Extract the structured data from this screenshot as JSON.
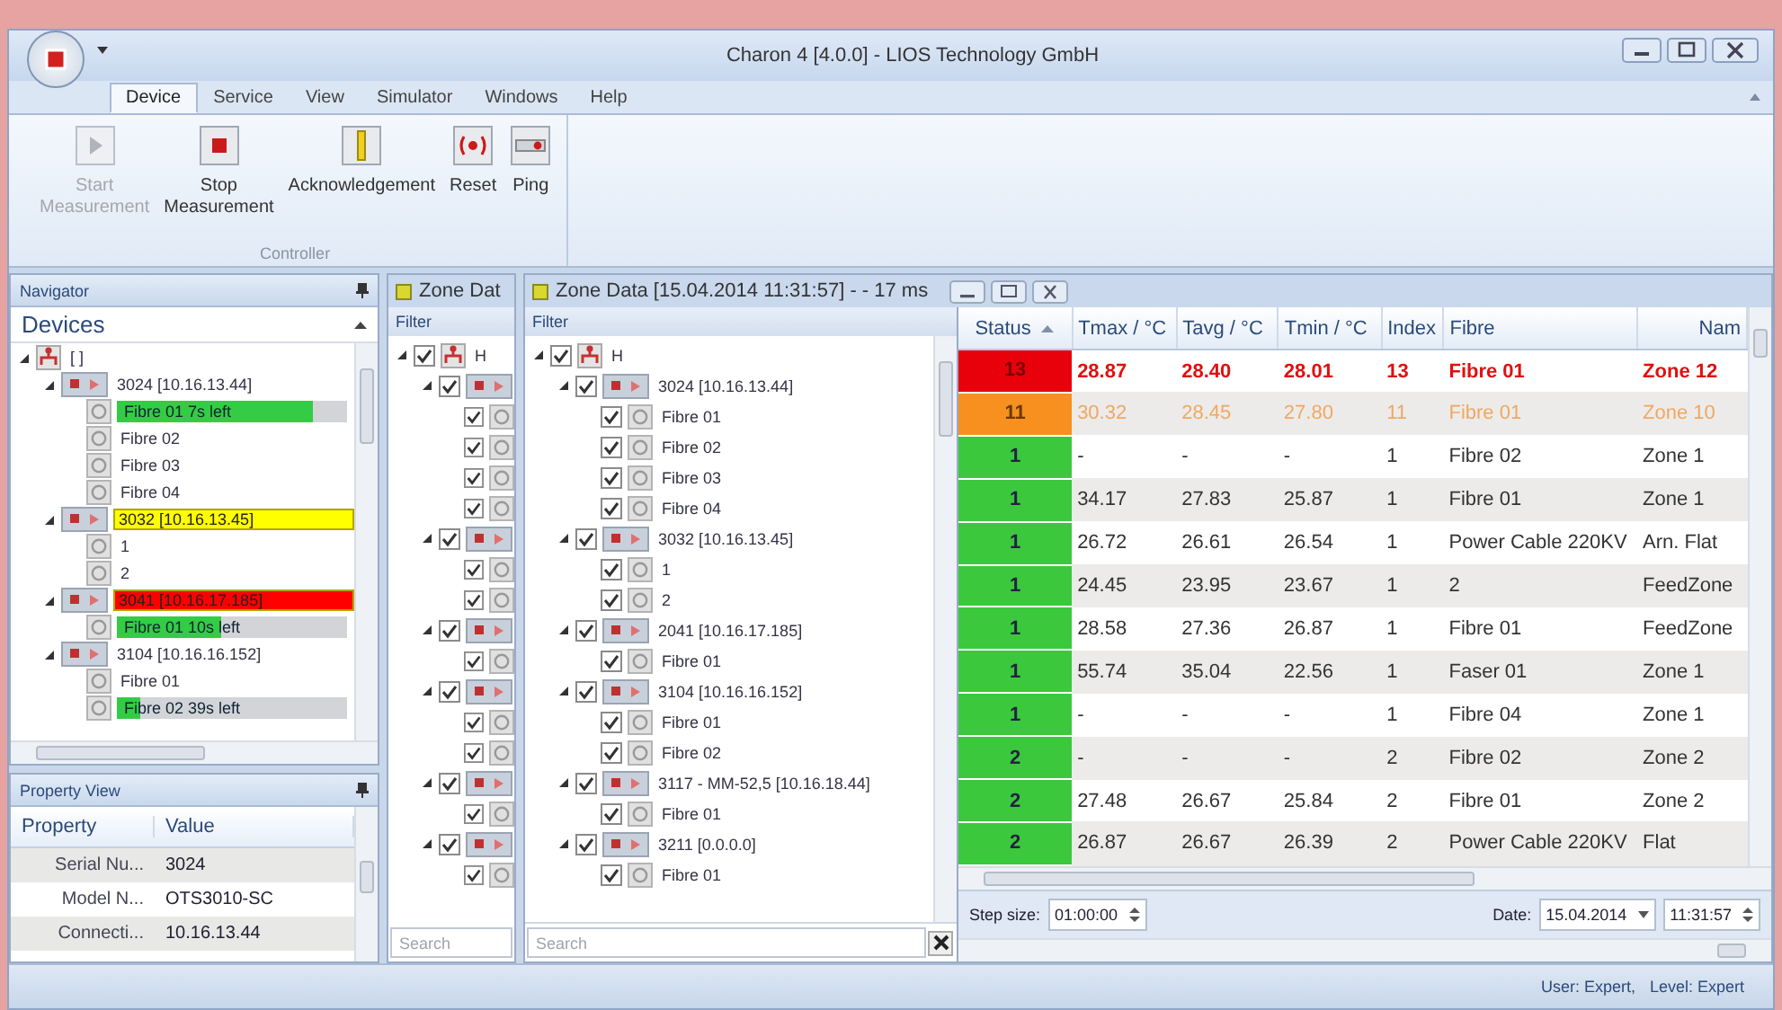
{
  "window": {
    "title": "Charon 4 [4.0.0] - LIOS Technology GmbH"
  },
  "ribbon": {
    "tabs": [
      {
        "label": "Device",
        "selected": true
      },
      {
        "label": "Service",
        "selected": false
      },
      {
        "label": "View",
        "selected": false
      },
      {
        "label": "Simulator",
        "selected": false
      },
      {
        "label": "Windows",
        "selected": false
      },
      {
        "label": "Help",
        "selected": false
      }
    ],
    "group": "Controller",
    "buttons": [
      {
        "label": "Start Measurement",
        "kind": "start",
        "disabled": true
      },
      {
        "label": "Stop Measurement",
        "kind": "stop",
        "disabled": false
      },
      {
        "label": "Acknowledgement",
        "kind": "acknowledge",
        "disabled": false
      },
      {
        "label": "Reset",
        "kind": "reset",
        "disabled": false
      },
      {
        "label": "Ping",
        "kind": "ping",
        "disabled": false
      }
    ]
  },
  "navigator": {
    "title": "Navigator",
    "header": "Devices",
    "tree": [
      {
        "label": "[ ]",
        "kind": "root",
        "expanded": true,
        "children": [
          {
            "label": "3024 [10.16.13.44]",
            "kind": "device",
            "expanded": true,
            "children": [
              {
                "label": "Fibre 01 7s left",
                "kind": "fibre",
                "level": 0.85
              },
              {
                "label": "Fibre 02",
                "kind": "fibre"
              },
              {
                "label": "Fibre 03",
                "kind": "fibre"
              },
              {
                "label": "Fibre 04",
                "kind": "fibre"
              }
            ]
          },
          {
            "label": "3032 [10.16.13.45]",
            "kind": "device",
            "expanded": true,
            "color": "#ffff00",
            "children": [
              {
                "label": "1",
                "kind": "fibre"
              },
              {
                "label": "2",
                "kind": "fibre"
              }
            ]
          },
          {
            "label": "3041 [10.16.17.185]",
            "kind": "device",
            "expanded": true,
            "color": "#ff0000",
            "children": [
              {
                "label": "Fibre 01 10s left",
                "kind": "fibre",
                "level": 0.45
              }
            ]
          },
          {
            "label": "3104 [10.16.16.152]",
            "kind": "device",
            "expanded": true,
            "children": [
              {
                "label": "Fibre 01",
                "kind": "fibre"
              },
              {
                "label": "Fibre 02 39s left",
                "kind": "fibre",
                "level": 0.1
              }
            ]
          }
        ]
      }
    ]
  },
  "property_view": {
    "title": "Property View",
    "columns": [
      "Property",
      "Value"
    ],
    "rows": [
      {
        "property": "Serial Nu...",
        "value": "3024"
      },
      {
        "property": "Model N...",
        "value": "OTS3010-SC"
      },
      {
        "property": "Connecti...",
        "value": "10.16.13.44"
      }
    ]
  },
  "back_panel": {
    "title": "Zone Dat",
    "filter_label": "Filter",
    "search": {
      "placeholder": "Search"
    },
    "tree": [
      {
        "label": "H",
        "kind": "root",
        "checked": true,
        "expanded": true,
        "children": [
          {
            "kind": "device",
            "checked": true,
            "expanded": true,
            "children": [
              {
                "kind": "fibre",
                "checked": true
              },
              {
                "kind": "fibre",
                "checked": true
              },
              {
                "kind": "fibre",
                "checked": true
              },
              {
                "kind": "fibre",
                "checked": true
              }
            ]
          },
          {
            "kind": "device",
            "checked": true,
            "expanded": true,
            "children": [
              {
                "kind": "fibre",
                "checked": true
              },
              {
                "kind": "fibre",
                "checked": true
              }
            ]
          },
          {
            "kind": "device",
            "checked": true,
            "expanded": true,
            "children": [
              {
                "kind": "fibre",
                "checked": true
              }
            ]
          },
          {
            "kind": "device",
            "checked": true,
            "expanded": true,
            "children": [
              {
                "kind": "fibre",
                "checked": true
              },
              {
                "kind": "fibre",
                "checked": true
              }
            ]
          },
          {
            "kind": "device",
            "checked": true,
            "expanded": true,
            "children": [
              {
                "kind": "fibre",
                "checked": true
              }
            ]
          },
          {
            "kind": "device",
            "checked": true,
            "expanded": true,
            "children": [
              {
                "kind": "fibre",
                "checked": true
              }
            ]
          }
        ]
      }
    ]
  },
  "zone_data": {
    "title": "Zone Data [15.04.2014 11:31:57] - - 17 ms",
    "filter_label": "Filter",
    "search": {
      "placeholder": "Search"
    },
    "tree": [
      {
        "label": "H",
        "kind": "root",
        "checked": true,
        "expanded": true,
        "children": [
          {
            "label": "3024 [10.16.13.44]",
            "kind": "device",
            "checked": true,
            "expanded": true,
            "children": [
              {
                "label": "Fibre 01",
                "kind": "fibre",
                "checked": true
              },
              {
                "label": "Fibre 02",
                "kind": "fibre",
                "checked": true
              },
              {
                "label": "Fibre 03",
                "kind": "fibre",
                "checked": true
              },
              {
                "label": "Fibre 04",
                "kind": "fibre",
                "checked": true
              }
            ]
          },
          {
            "label": "3032 [10.16.13.45]",
            "kind": "device",
            "checked": true,
            "expanded": true,
            "children": [
              {
                "label": "1",
                "kind": "fibre",
                "checked": true
              },
              {
                "label": "2",
                "kind": "fibre",
                "checked": true
              }
            ]
          },
          {
            "label": "2041 [10.16.17.185]",
            "kind": "device",
            "checked": true,
            "expanded": true,
            "children": [
              {
                "label": "Fibre 01",
                "kind": "fibre",
                "checked": true
              }
            ]
          },
          {
            "label": "3104 [10.16.16.152]",
            "kind": "device",
            "checked": true,
            "expanded": true,
            "children": [
              {
                "label": "Fibre 01",
                "kind": "fibre",
                "checked": true
              },
              {
                "label": "Fibre 02",
                "kind": "fibre",
                "checked": true
              }
            ]
          },
          {
            "label": "3117 - MM-52,5 [10.16.18.44]",
            "kind": "device",
            "checked": true,
            "expanded": true,
            "children": [
              {
                "label": "Fibre 01",
                "kind": "fibre",
                "checked": true
              }
            ]
          },
          {
            "label": "3211 [0.0.0.0]",
            "kind": "device",
            "checked": true,
            "expanded": true,
            "children": [
              {
                "label": "Fibre 01",
                "kind": "fibre",
                "checked": true
              }
            ]
          }
        ]
      }
    ],
    "table": {
      "columns": [
        "Status",
        "Tmax / °C",
        "Tavg / °C",
        "Tmin / °C",
        "Index",
        "Fibre",
        "Nam"
      ],
      "rows": [
        {
          "kind": "alarm",
          "color": "#e8000b",
          "cells": [
            "13",
            "28.87",
            "28.40",
            "28.01",
            "13",
            "Fibre 01",
            "Zone 12"
          ]
        },
        {
          "kind": "warning",
          "color": "#f7901e",
          "cells": [
            "11",
            "30.32",
            "28.45",
            "27.80",
            "11",
            "Fibre 01",
            "Zone 10"
          ]
        },
        {
          "kind": "normal",
          "color": "#3cc83c",
          "cells": [
            "1",
            "-",
            "-",
            "-",
            "1",
            "Fibre 02",
            "Zone 1"
          ]
        },
        {
          "kind": "normal",
          "color": "#3cc83c",
          "cells": [
            "1",
            "34.17",
            "27.83",
            "25.87",
            "1",
            "Fibre 01",
            "Zone 1"
          ]
        },
        {
          "kind": "normal",
          "color": "#3cc83c",
          "cells": [
            "1",
            "26.72",
            "26.61",
            "26.54",
            "1",
            "Power Cable 220KV",
            "Arn. Flat"
          ]
        },
        {
          "kind": "normal",
          "color": "#3cc83c",
          "cells": [
            "1",
            "24.45",
            "23.95",
            "23.67",
            "1",
            "2",
            "FeedZone"
          ]
        },
        {
          "kind": "normal",
          "color": "#3cc83c",
          "cells": [
            "1",
            "28.58",
            "27.36",
            "26.87",
            "1",
            "Fibre 01",
            "FeedZone"
          ]
        },
        {
          "kind": "normal",
          "color": "#3cc83c",
          "cells": [
            "1",
            "55.74",
            "35.04",
            "22.56",
            "1",
            "Faser 01",
            "Zone 1"
          ]
        },
        {
          "kind": "normal",
          "color": "#3cc83c",
          "cells": [
            "1",
            "-",
            "-",
            "-",
            "1",
            "Fibre 04",
            "Zone 1"
          ]
        },
        {
          "kind": "normal",
          "color": "#3cc83c",
          "cells": [
            "2",
            "-",
            "-",
            "-",
            "2",
            "Fibre 02",
            "Zone 2"
          ]
        },
        {
          "kind": "normal",
          "color": "#3cc83c",
          "cells": [
            "2",
            "27.48",
            "26.67",
            "25.84",
            "2",
            "Fibre 01",
            "Zone 2"
          ]
        },
        {
          "kind": "normal",
          "color": "#3cc83c",
          "cells": [
            "2",
            "26.87",
            "26.67",
            "26.39",
            "2",
            "Power Cable 220KV",
            "Flat"
          ]
        }
      ]
    },
    "step_size": {
      "label": "Step size:",
      "value": "01:00:00"
    },
    "date": {
      "label": "Date:",
      "value": "15.04.2014",
      "time": "11:31:57"
    }
  },
  "status_bar": {
    "user": "User: Expert,",
    "level": "Level: Expert"
  }
}
